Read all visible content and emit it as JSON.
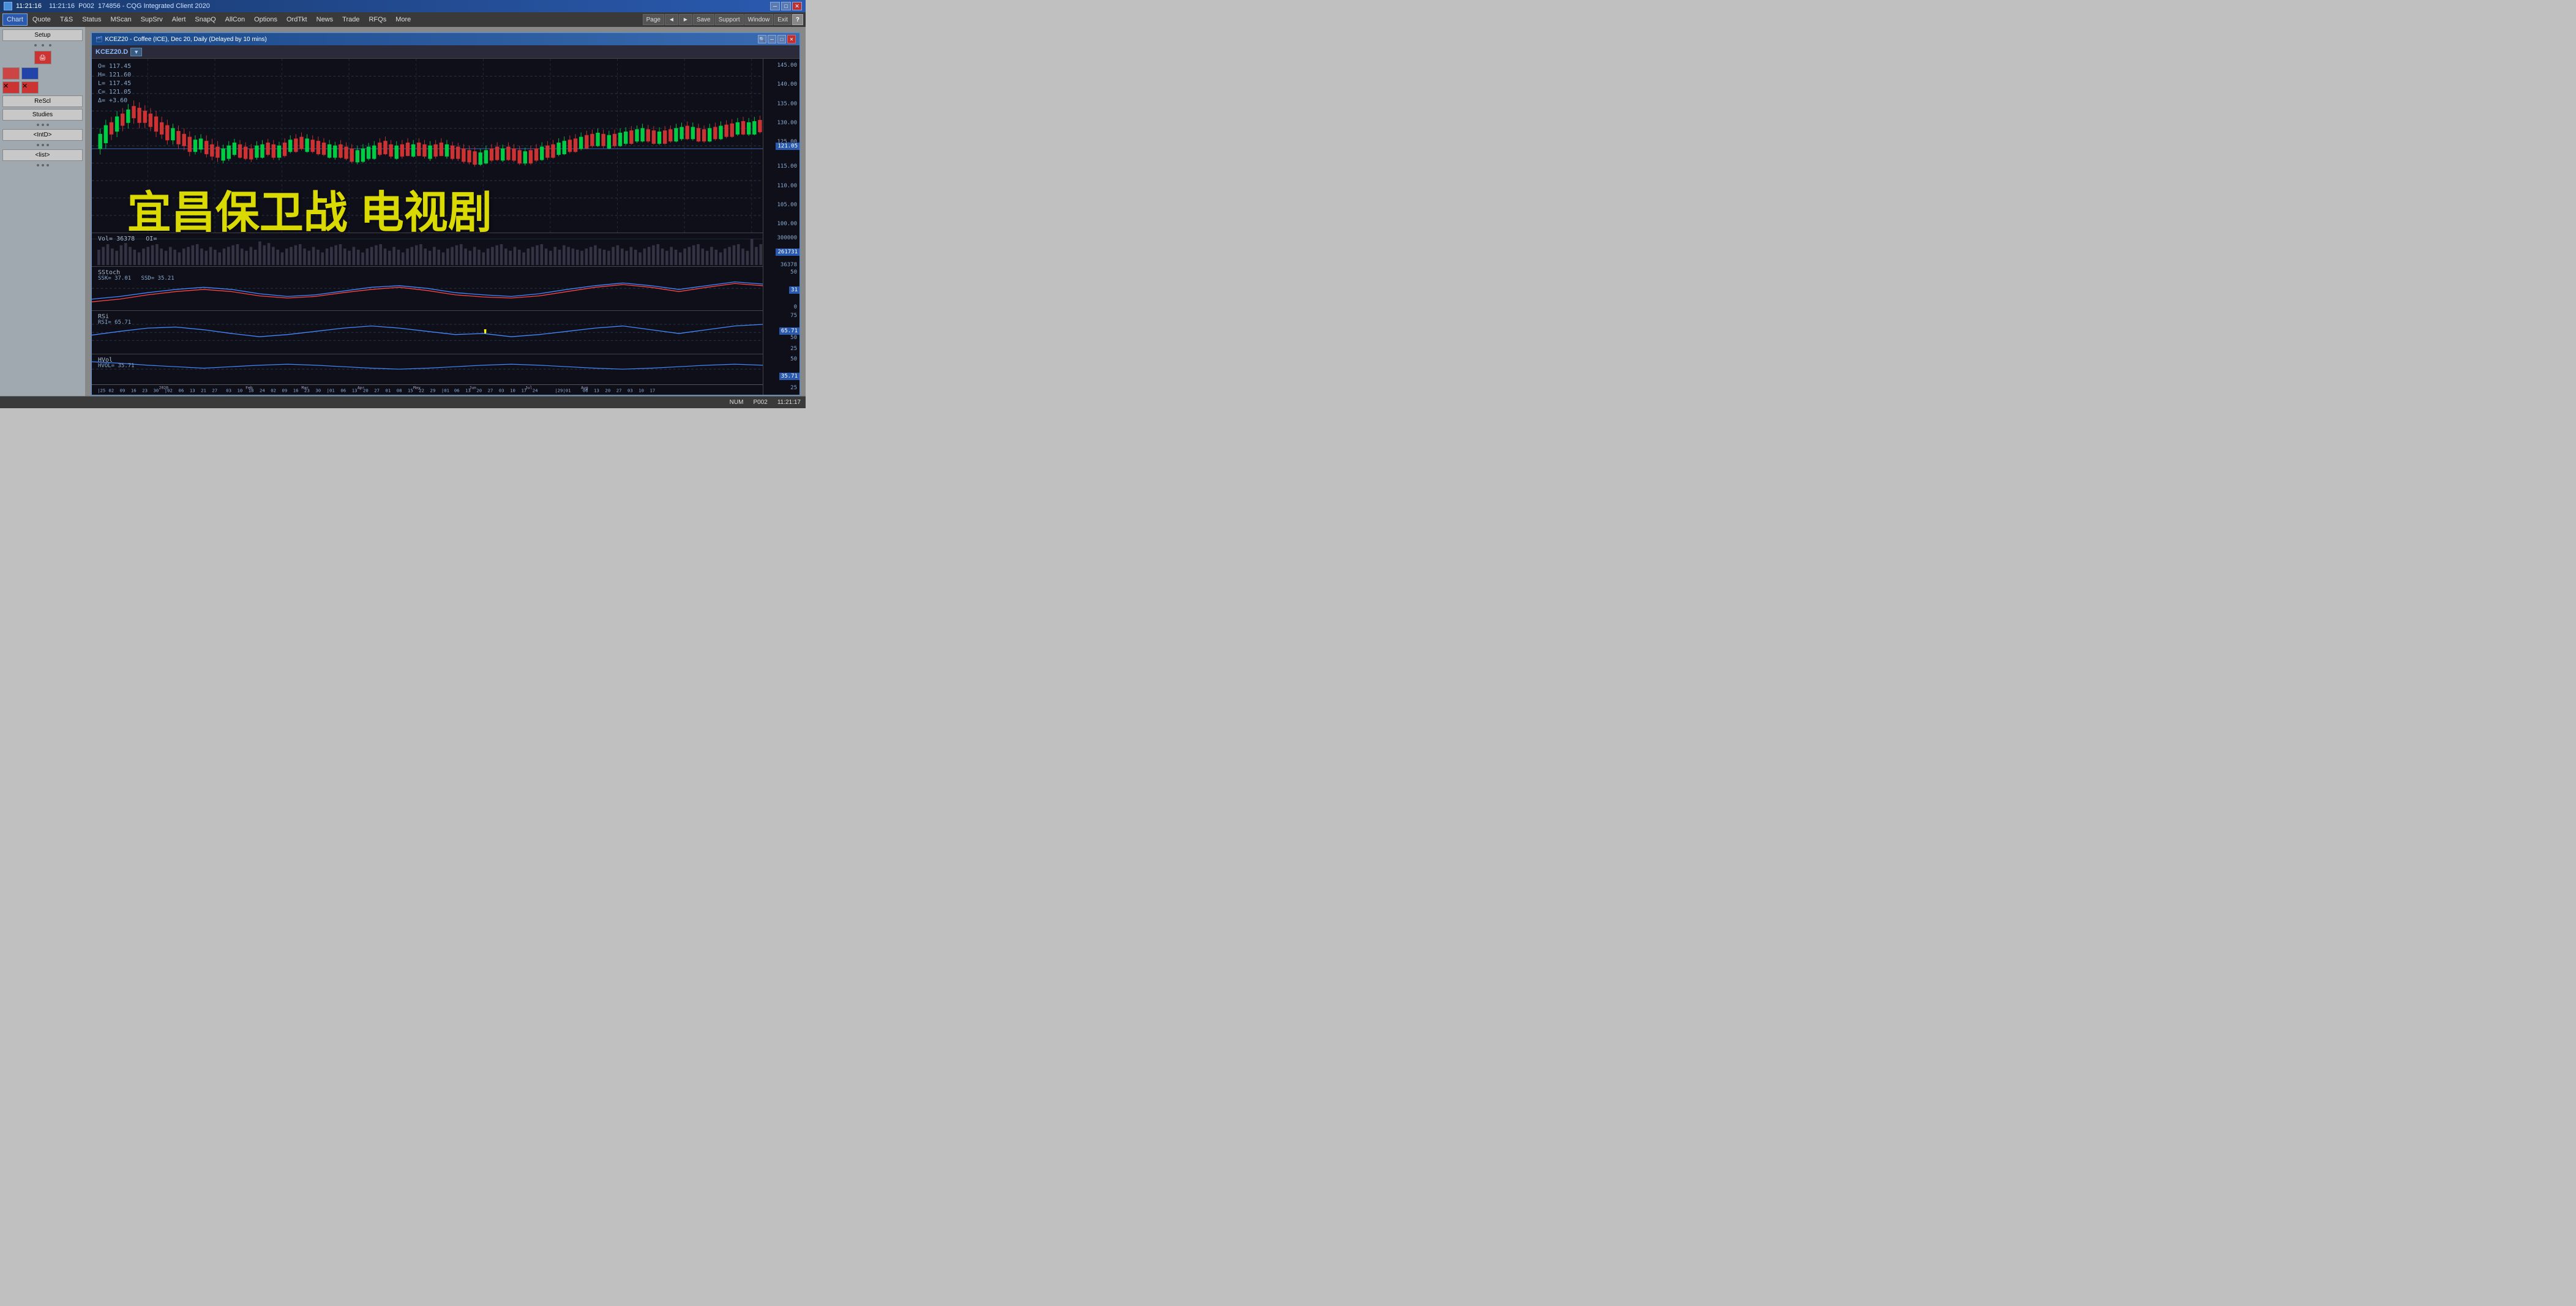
{
  "titlebar": {
    "time": "11:21:16",
    "account": "P002",
    "id": "174856",
    "app": "CQG Integrated Client 2020",
    "minimize": "─",
    "maximize": "□",
    "close": "✕"
  },
  "menubar": {
    "items": [
      {
        "label": "Chart",
        "active": true
      },
      {
        "label": "Quote"
      },
      {
        "label": "T&S"
      },
      {
        "label": "Status"
      },
      {
        "label": "MScan"
      },
      {
        "label": "SupSrv"
      },
      {
        "label": "Alert"
      },
      {
        "label": "SnapQ"
      },
      {
        "label": "AllCon"
      },
      {
        "label": "Options"
      },
      {
        "label": "OrdTkt"
      },
      {
        "label": "News"
      },
      {
        "label": "Trade"
      },
      {
        "label": "RFQs"
      },
      {
        "label": "More"
      }
    ]
  },
  "right_toolbar": {
    "items": [
      "Page",
      "◄",
      "►",
      "Save",
      "Support",
      "Window",
      "Exit",
      "?"
    ]
  },
  "sidebar": {
    "setup": "Setup",
    "rescl": "ReScl",
    "studies": "Studies",
    "intd": "<IntD>",
    "list": "<list>"
  },
  "chart": {
    "title": "KCEZ20 - Coffee (ICE), Dec 20, Daily (Delayed by 10 mins)",
    "symbol": "KCEZ20.D",
    "ohlc": {
      "open": "O= 117.45",
      "high": "H= 121.60",
      "low": "L= 117.45",
      "close": "C= 121.05",
      "delta": "Δ= +3.60"
    },
    "vol_info": {
      "vol": "Vol= 36378",
      "oi": "OI="
    },
    "sstoch_info": {
      "ssk": "SSK= 37.01",
      "ssd": "SSD= 35.21"
    },
    "rsi_info": {
      "rsi": "RSI= 65.71"
    },
    "hvol_info": {
      "hvol": "HVOL= 35.71"
    },
    "y_axis": {
      "main": [
        "145.00",
        "140.00",
        "135.00",
        "130.00",
        "125.00",
        "121.05",
        "115.00",
        "110.00",
        "105.00",
        "100.00"
      ],
      "vol": [
        "300000",
        "261731",
        "36378"
      ],
      "sstoch": [
        "50",
        "31",
        "0"
      ],
      "rsi": [
        "75",
        "65.71",
        "50",
        "25"
      ],
      "hvol": [
        "50",
        "35.71",
        "25"
      ]
    },
    "date_axis": [
      "|25",
      "02",
      "09",
      "16",
      "23",
      "30|02",
      "06",
      "13",
      "21",
      "27",
      "03",
      "10",
      "18",
      "24",
      "02",
      "09",
      "16",
      "23",
      "30|01",
      "06",
      "13",
      "20",
      "01",
      "08",
      "15",
      "22",
      "29|01",
      "06",
      "13",
      "20",
      "27",
      "03",
      "10",
      "17"
    ],
    "date_labels": [
      "2020",
      "Feb",
      "Mar",
      "Apr",
      "May",
      "Jun",
      "Jul",
      "Aug"
    ]
  },
  "statusbar": {
    "num": "NUM",
    "account": "P002",
    "time": "11:21:17"
  },
  "watermark": {
    "text": "宜昌保卫战 电视剧"
  }
}
